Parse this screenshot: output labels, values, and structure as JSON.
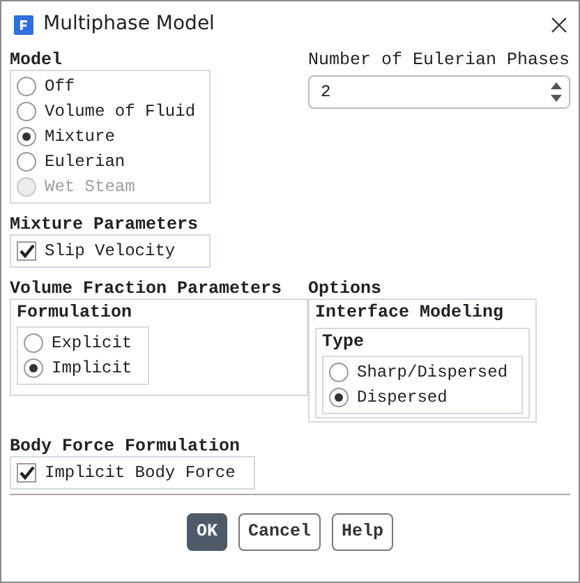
{
  "window": {
    "title": "Multiphase Model"
  },
  "model": {
    "title": "Model",
    "options": [
      {
        "label": "Off",
        "selected": false,
        "disabled": false
      },
      {
        "label": "Volume of Fluid",
        "selected": false,
        "disabled": false
      },
      {
        "label": "Mixture",
        "selected": true,
        "disabled": false
      },
      {
        "label": "Eulerian",
        "selected": false,
        "disabled": false
      },
      {
        "label": "Wet Steam",
        "selected": false,
        "disabled": true
      }
    ]
  },
  "eulerian_phases": {
    "label": "Number of Eulerian Phases",
    "value": "2"
  },
  "mixture_parameters": {
    "title": "Mixture Parameters",
    "options": [
      {
        "label": "Slip Velocity",
        "checked": true
      }
    ]
  },
  "volume_fraction_parameters": {
    "title": "Volume Fraction Parameters",
    "formulation": {
      "title": "Formulation",
      "options": [
        {
          "label": "Explicit",
          "selected": false,
          "disabled": false
        },
        {
          "label": "Implicit",
          "selected": true,
          "disabled": false
        }
      ]
    }
  },
  "options": {
    "title": "Options",
    "interface_modeling": {
      "title": "Interface Modeling",
      "type": {
        "title": "Type",
        "options": [
          {
            "label": "Sharp/Dispersed",
            "selected": false,
            "disabled": false
          },
          {
            "label": "Dispersed",
            "selected": true,
            "disabled": false
          }
        ]
      }
    }
  },
  "body_force_formulation": {
    "title": "Body Force Formulation",
    "options": [
      {
        "label": "Implicit Body Force",
        "checked": true
      }
    ]
  },
  "buttons": [
    {
      "label": "OK",
      "primary": true
    },
    {
      "label": "Cancel",
      "primary": false
    },
    {
      "label": "Help",
      "primary": false
    }
  ]
}
